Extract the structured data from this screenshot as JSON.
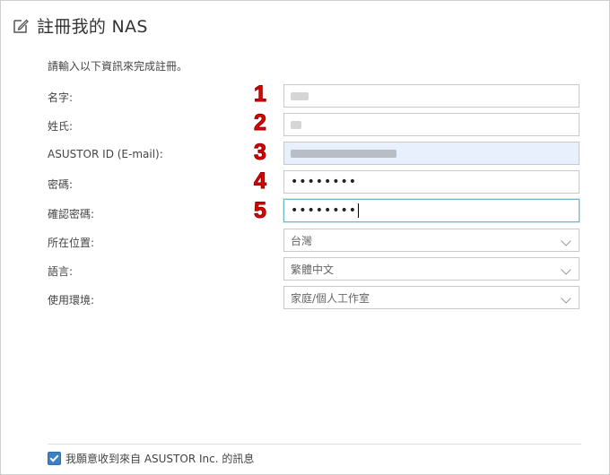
{
  "header": {
    "title": "註冊我的 NAS",
    "icon": "edit-icon"
  },
  "intro": "請輸入以下資訊來完成註冊。",
  "fields": [
    {
      "label": "名字:",
      "step": "1"
    },
    {
      "label": "姓氏:",
      "step": "2"
    },
    {
      "label": "ASUSTOR ID (E-mail):",
      "step": "3"
    },
    {
      "label": "密碼:",
      "step": "4",
      "value": "••••••••"
    },
    {
      "label": "確認密碼:",
      "step": "5",
      "value": "••••••••"
    },
    {
      "label": "所在位置:",
      "value": "台灣"
    },
    {
      "label": "語言:",
      "value": "繁體中文"
    },
    {
      "label": "使用環境:",
      "value": "家庭/個人工作室"
    }
  ],
  "consent": {
    "label": "我願意收到來自 ASUSTOR Inc. 的訊息",
    "checked": true
  },
  "colors": {
    "step_number": "#e60000",
    "checkbox": "#3a82c4",
    "autofill_bg": "#e8f0fe"
  }
}
